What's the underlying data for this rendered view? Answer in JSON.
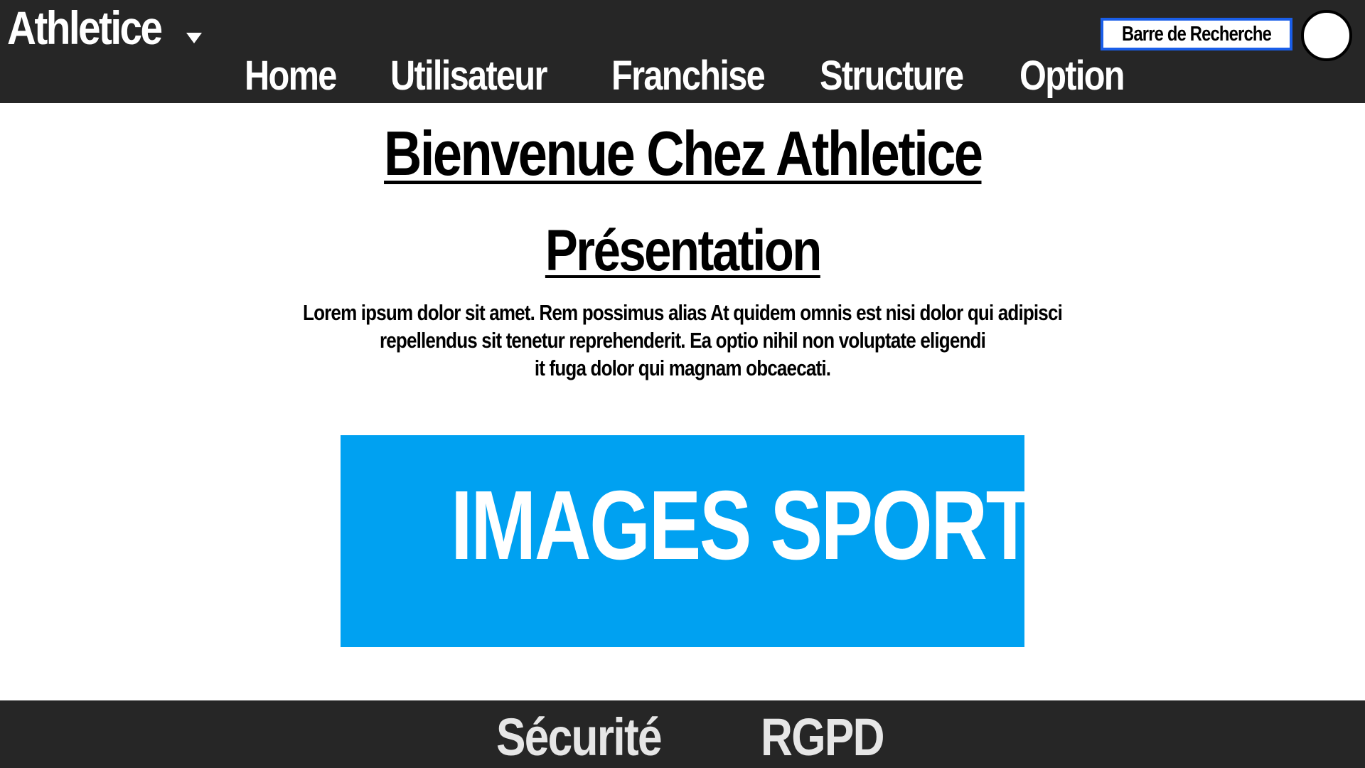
{
  "header": {
    "brand": "Athletice",
    "brand_menu_icon": "caret-down-icon",
    "nav": {
      "home": "Home",
      "utilisateur": "Utilisateur",
      "franchise": "Franchise",
      "structure": "Structure",
      "option": "Option"
    },
    "search_label": "Barre de Recherche",
    "avatar_icon": "user-avatar-icon"
  },
  "main": {
    "title": "Bienvenue Chez Athletice",
    "section_title": "Présentation",
    "intro_lines": [
      "Lorem ipsum dolor sit amet. Rem possimus alias At quidem omnis est nisi dolor qui adipisci",
      "repellendus sit tenetur reprehenderit. Ea optio nihil non voluptate eligendi",
      "it fuga dolor qui magnam obcaecati."
    ],
    "banner_text": "IMAGES SPORT"
  },
  "footer": {
    "securite": "Sécurité",
    "rgpd": "RGPD"
  },
  "colors": {
    "header_bg": "#262626",
    "footer_bg": "#262626",
    "banner_bg": "#00a1f1",
    "search_border": "#1a5ee8",
    "text_light": "#ffffff",
    "text_dark": "#000000"
  }
}
